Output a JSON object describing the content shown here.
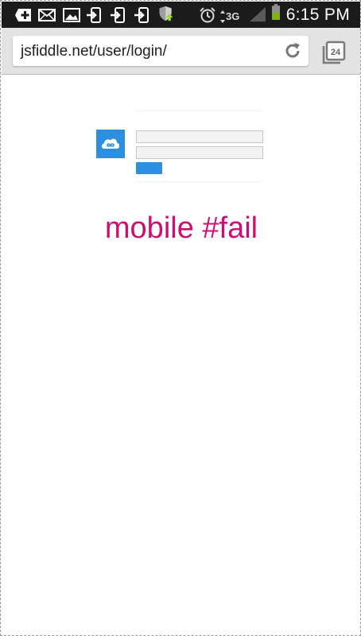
{
  "status_bar": {
    "time": "6:15 PM",
    "network": "3G",
    "icons": [
      "add-box-icon",
      "mail-icon",
      "image-icon",
      "usb-icon",
      "usb-icon",
      "usb-icon",
      "shield-upload-icon",
      "alarm-icon",
      "signal-icon",
      "battery-icon"
    ]
  },
  "browser": {
    "url": "jsfiddle.net/user/login/",
    "tab_count": "24",
    "reload_icon": "reload-icon",
    "tabs_icon": "tabs-icon"
  },
  "page": {
    "logo_icon": "cloud-infinity-icon",
    "username_value": "",
    "password_value": "",
    "submit_label": "",
    "caption": "mobile #fail"
  },
  "colors": {
    "accent": "#2d8fe0",
    "caption": "#cc0e74",
    "status_bar": "#1b1b1b",
    "toolbar": "#e3e3e3"
  }
}
